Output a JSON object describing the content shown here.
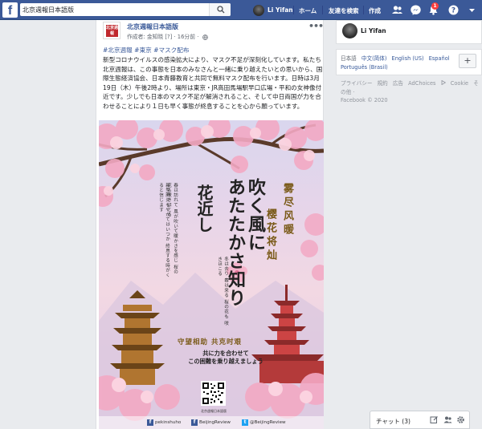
{
  "topbar": {
    "logo": "f",
    "search_value": "北京週報日本語版",
    "user_name": "Li Yifan",
    "home": "ホーム",
    "find_friends": "友達を検索",
    "create": "作成",
    "notifications_count": "1"
  },
  "post": {
    "page_name": "北京週報日本語版",
    "meta": "作成者: 金知晓 [?] · 16分前 ·",
    "avatar_text": "北京週報",
    "hashtags": "#北京週報 #東京 #マスク配布",
    "body": "新型コロナウイルスの感染拡大により、マスク不足が深刻化しています。私たち北京週報は、この事態を日本のみなさんと一緒に乗り越えたいとの思いから、国際生態経済協会、日本青藤教育と共同で無料マスク配布を行います。日時は3月19日（木）午後2時より、場所は東京・JR高田馬場駅早口広場・平和の女神像付近です。少しでも日本のマスク不足が解消されること、そして中日両国が力を合わせることにより１日も早く事態が終息することを心から願っています。"
  },
  "poster": {
    "col1": "吹く風に",
    "col2": "あたたかさ知り",
    "col3": "花近し",
    "gold1": "雾尽风暖",
    "gold2": "樱花将灿",
    "small1": "冬は去り 春は来る 桜の花も 咲きほこる",
    "small2": "新型肺炎もやがてはいつか 終息する時がくると信じます",
    "small3": "春は訪れて 風が吹いて暖かさを感じ 桜の花も咲きほこる",
    "slogan_cn": "守望相助  共克时艰",
    "slogan_jp1": "共に力を合わせて",
    "slogan_jp2": "この困難を乗り越えましょう",
    "qr_caption": "北京週報日本語版",
    "social": [
      {
        "icon": "f",
        "label": "pekinshuho",
        "color": "#3b5998"
      },
      {
        "icon": "f",
        "label": "BeijingReview",
        "color": "#3b5998"
      },
      {
        "icon": "t",
        "label": "@BeijingReview",
        "color": "#1da1f2"
      }
    ]
  },
  "sidebar": {
    "user_name": "Li Yifan",
    "languages_line1": [
      "日本語",
      "中文(简体)",
      "English (US)",
      "Español"
    ],
    "languages_line2": [
      "Português (Brasil)"
    ],
    "footer_links": [
      "プライバシー",
      "規約",
      "広告",
      "AdChoices",
      "Cookie",
      "その他 ·"
    ],
    "copyright": "Facebook © 2020"
  },
  "chat": {
    "label": "チャット (3)"
  },
  "colors": {
    "brand": "#3b5998",
    "link": "#385898",
    "badge": "#fa3e3e"
  }
}
